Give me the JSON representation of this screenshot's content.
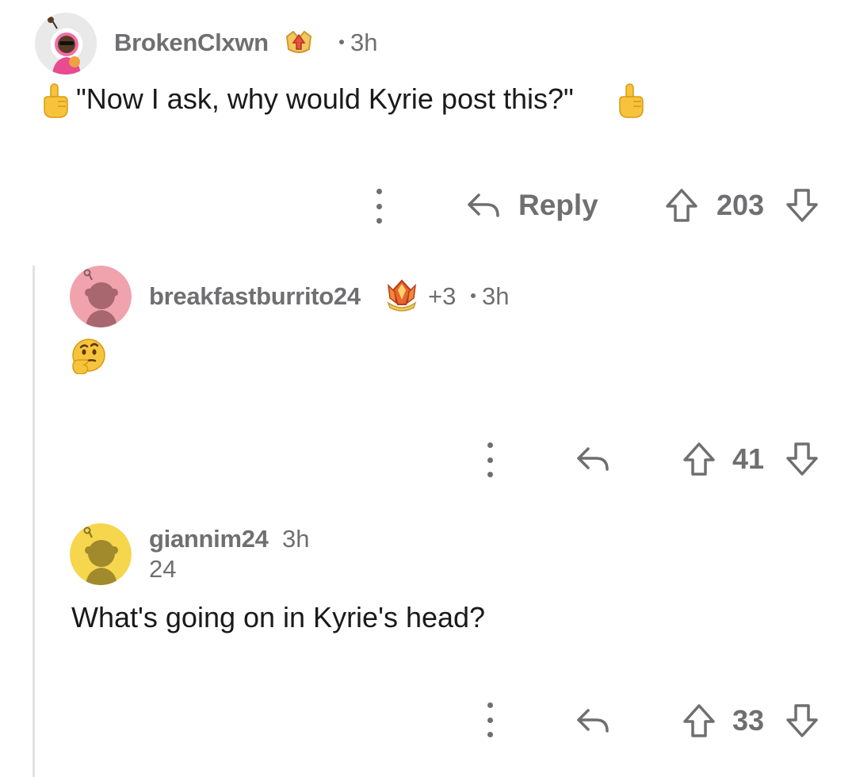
{
  "comments": [
    {
      "username": "BrokenClxwn",
      "time": "3h",
      "body": "\"Now I ask, why would Kyrie post this?\"",
      "reply_label": "Reply",
      "votes": "203"
    },
    {
      "username": "breakfastburrito24",
      "award_count": "+3",
      "time": "3h",
      "body_emoji": "thinking-face",
      "votes": "41"
    },
    {
      "username": "giannim24",
      "time": "3h",
      "flair": "24",
      "body": "What's going on in Kyrie's head?",
      "votes": "33"
    }
  ],
  "colors": {
    "meta_gray": "#6f6f72",
    "thread_line": "#e2e2e2",
    "avatar_pink": "#f0a3ad",
    "avatar_yellow": "#f5d64d"
  }
}
